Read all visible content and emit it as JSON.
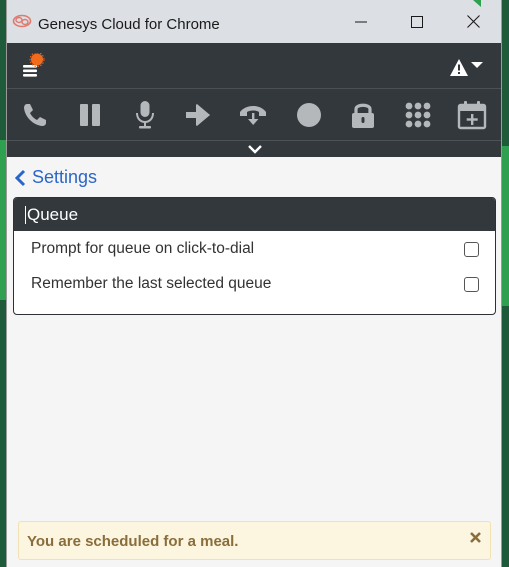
{
  "window": {
    "title": "Genesys Cloud for Chrome"
  },
  "toolbar": {
    "icons": [
      "phone-icon",
      "pause-icon",
      "microphone-icon",
      "transfer-arrow-icon",
      "voicemail-drop-icon",
      "record-icon",
      "lock-icon",
      "dialpad-icon",
      "schedule-callback-icon"
    ]
  },
  "nav": {
    "back_label": "Settings"
  },
  "queue_panel": {
    "header": "Queue",
    "options": [
      {
        "label": "Prompt for queue on click-to-dial",
        "checked": false
      },
      {
        "label": "Remember the last selected queue",
        "checked": false
      }
    ]
  },
  "notice": {
    "text": "You are scheduled for a meal."
  },
  "colors": {
    "titlebar_bg": "#dcdfe4",
    "appbar_bg": "#33383d",
    "icon_gray": "#b5b8bb",
    "link_blue": "#2a66c9",
    "notification_dot": "#f26b1d",
    "notice_bg": "#fcf6e1",
    "notice_text": "#8a6d3b"
  }
}
